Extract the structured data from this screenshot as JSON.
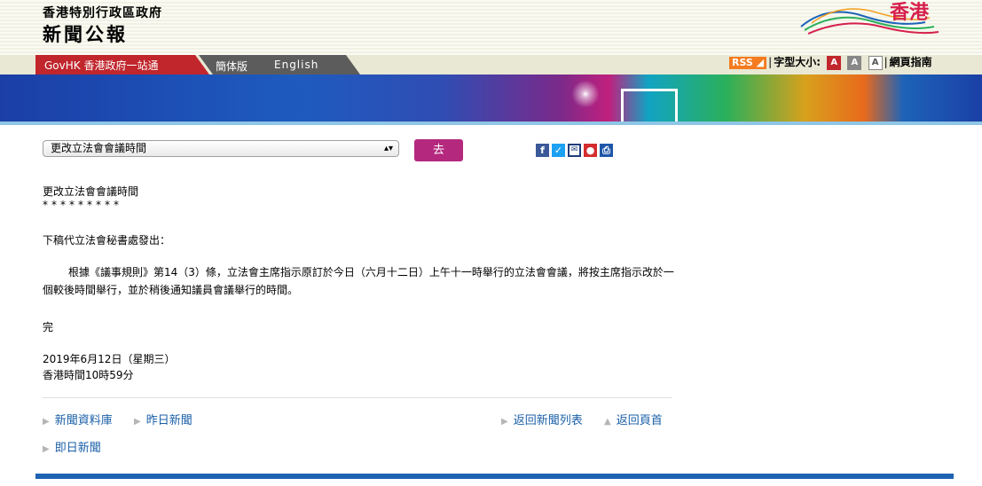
{
  "header": {
    "gov_name": "香港特別行政區政府",
    "site_name": "新聞公報",
    "logo_text": "香港",
    "tabs": {
      "govhk": "GovHK 香港政府一站通",
      "simplified": "簡体版",
      "english": "English"
    },
    "toolbar": {
      "rss": "RSS",
      "font_size_label": "字型大小:",
      "font_sizes": [
        "A",
        "A",
        "A"
      ],
      "guide": "網頁指南"
    }
  },
  "nav": {
    "select_value": "更改立法會會議時間",
    "go_label": "去",
    "share_icons": [
      "facebook-icon",
      "twitter-icon",
      "email-icon",
      "weibo-icon",
      "print-icon"
    ]
  },
  "article": {
    "title": "更改立法會會議時間",
    "stars": "*********",
    "intro": "下稿代立法會秘書處發出：",
    "body": "根據《議事規則》第14（3）條，立法會主席指示原訂於今日（六月十二日）上午十一時舉行的立法會會議，將按主席指示改於一個較後時間舉行，並於稍後通知議員會議舉行的時間。",
    "end": "完",
    "date": "2019年6月12日（星期三）",
    "time": "香港時間10時59分"
  },
  "footer_links": {
    "archive": "新聞資料庫",
    "yesterday": "昨日新聞",
    "back_list": "返回新聞列表",
    "top": "返回頁首",
    "today": "即日新聞"
  }
}
